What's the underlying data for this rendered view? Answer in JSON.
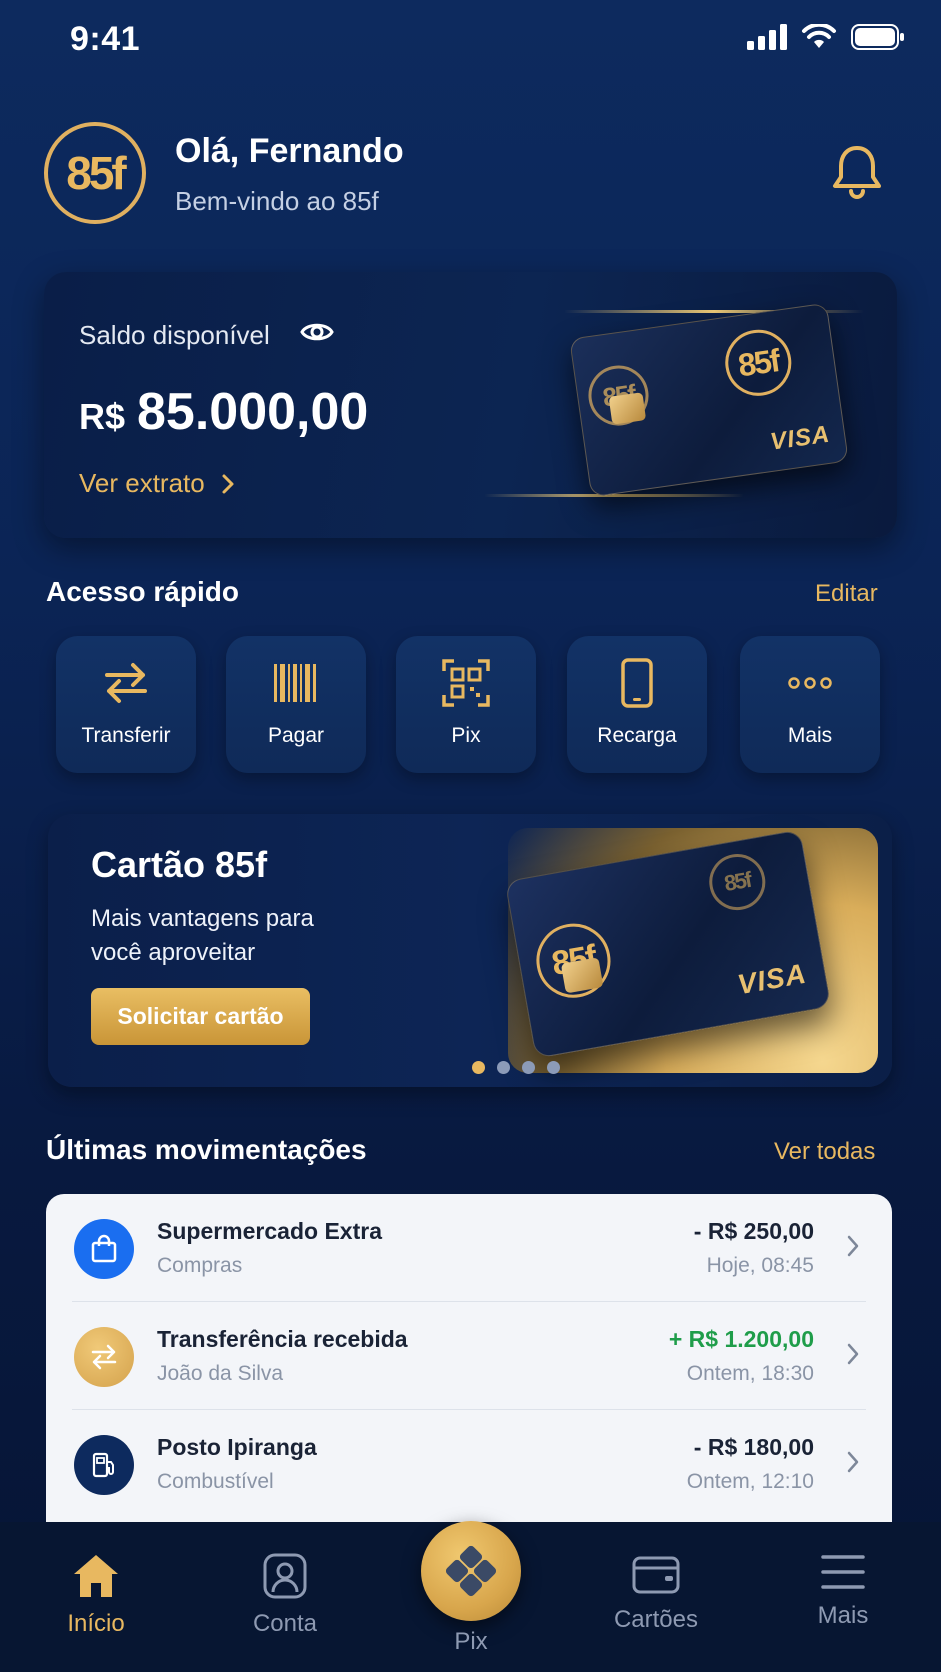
{
  "status_bar": {
    "time": "9:41"
  },
  "header": {
    "logo_text": "85f",
    "greeting": "Olá, Fernando",
    "subtitle": "Bem-vindo ao 85f"
  },
  "balance": {
    "label": "Saldo disponível",
    "currency": "R$",
    "value": "85.000,00",
    "link": "Ver extrato",
    "card_logo": "85f",
    "card_brand": "VISA"
  },
  "quick_access": {
    "title": "Acesso rápido",
    "edit_label": "Editar",
    "items": [
      {
        "label": "Transferir",
        "icon": "transfer-icon"
      },
      {
        "label": "Pagar",
        "icon": "barcode-icon"
      },
      {
        "label": "Pix",
        "icon": "qr-code-icon"
      },
      {
        "label": "Recarga",
        "icon": "phone-icon"
      },
      {
        "label": "Mais",
        "icon": "more-dots-icon"
      }
    ]
  },
  "promo": {
    "title": "Cartão 85f",
    "subtitle": "Mais vantagens para você aproveitar",
    "button": "Solicitar cartão",
    "card_logo": "85f",
    "card_brand": "VISA",
    "pages": 4,
    "active_page": 1
  },
  "transactions": {
    "title": "Últimas movimentações",
    "see_all": "Ver todas",
    "items": [
      {
        "title": "Supermercado Extra",
        "category": "Compras",
        "amount": "- R$ 250,00",
        "date": "Hoje, 08:45",
        "icon": "shopping-bag-icon",
        "icon_bg": "#1a6ef0"
      },
      {
        "title": "Transferência recebida",
        "category": "João da Silva",
        "amount": "+ R$ 1.200,00",
        "date": "Ontem, 18:30",
        "icon": "transfer-icon",
        "icon_bg": "#e0b35a"
      },
      {
        "title": "Posto Ipiranga",
        "category": "Combustível",
        "amount": "- R$ 180,00",
        "date": "Ontem, 12:10",
        "icon": "fuel-pump-icon",
        "icon_bg": "#0d2a5e"
      }
    ]
  },
  "bottom_nav": {
    "items": [
      {
        "label": "Início",
        "icon": "home-icon",
        "active": true
      },
      {
        "label": "Conta",
        "icon": "user-icon"
      },
      {
        "label": "Pix",
        "icon": "pix-icon"
      },
      {
        "label": "Cartões",
        "icon": "wallet-icon"
      },
      {
        "label": "Mais",
        "icon": "menu-icon"
      }
    ]
  },
  "colors": {
    "accent_gold": "#e8b860",
    "background": "#0b2455",
    "positive": "#1f9d4a"
  }
}
